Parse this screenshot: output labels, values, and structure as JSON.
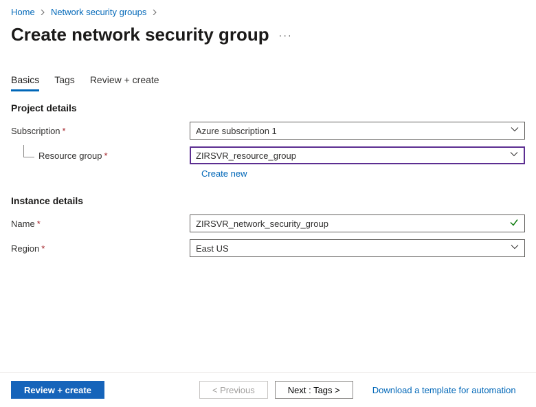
{
  "breadcrumb": {
    "home": "Home",
    "nsg": "Network security groups"
  },
  "title": "Create network security group",
  "tabs": {
    "basics": "Basics",
    "tags": "Tags",
    "review": "Review + create"
  },
  "sections": {
    "project": "Project details",
    "instance": "Instance details"
  },
  "labels": {
    "subscription": "Subscription",
    "resourceGroup": "Resource group",
    "name": "Name",
    "region": "Region"
  },
  "values": {
    "subscription": "Azure subscription 1",
    "resourceGroup": "ZIRSVR_resource_group",
    "name": "ZIRSVR_network_security_group",
    "region": "East US"
  },
  "links": {
    "createNew": "Create new",
    "downloadTemplate": "Download a template for automation"
  },
  "buttons": {
    "reviewCreate": "Review + create",
    "previous": "< Previous",
    "next": "Next : Tags >"
  }
}
